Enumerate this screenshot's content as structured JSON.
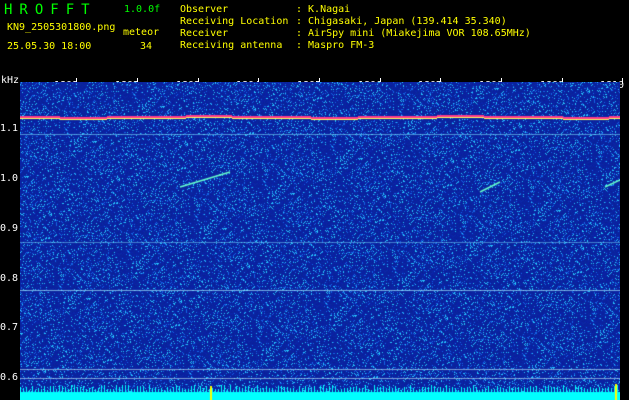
{
  "header": {
    "brand": "HROFFT",
    "version": "1.0.0f",
    "filename": "KN9_2505301800.png",
    "datetime": "25.05.30 18:00",
    "meteor_label": "meteor",
    "meteor_count": "34",
    "fields": [
      {
        "label": "Observer",
        "value": ": K.Nagai"
      },
      {
        "label": "Receiving Location",
        "value": ": Chigasaki, Japan (139.414 35.340)"
      },
      {
        "label": "Receiver",
        "value": ": AirSpy mini (Miakejima VOR 108.65MHz)"
      },
      {
        "label": "Receiving antenna",
        "value": ": Maspro FM-3"
      }
    ]
  },
  "spectrogram": {
    "y_unit": "kHz",
    "x_ticks": [
      "1801",
      "1802",
      "1803",
      "1804",
      "1805",
      "1806",
      "1807",
      "1808",
      "1809",
      "1810"
    ],
    "y_ticks": [
      "1.1",
      "1.0",
      "0.9",
      "0.8",
      "0.7",
      "0.6"
    ],
    "colors": {
      "background": "#0a1e9a",
      "noise": "#2fd0ff",
      "carrier": "#ff3a8a",
      "floor": "#00ffff"
    }
  }
}
